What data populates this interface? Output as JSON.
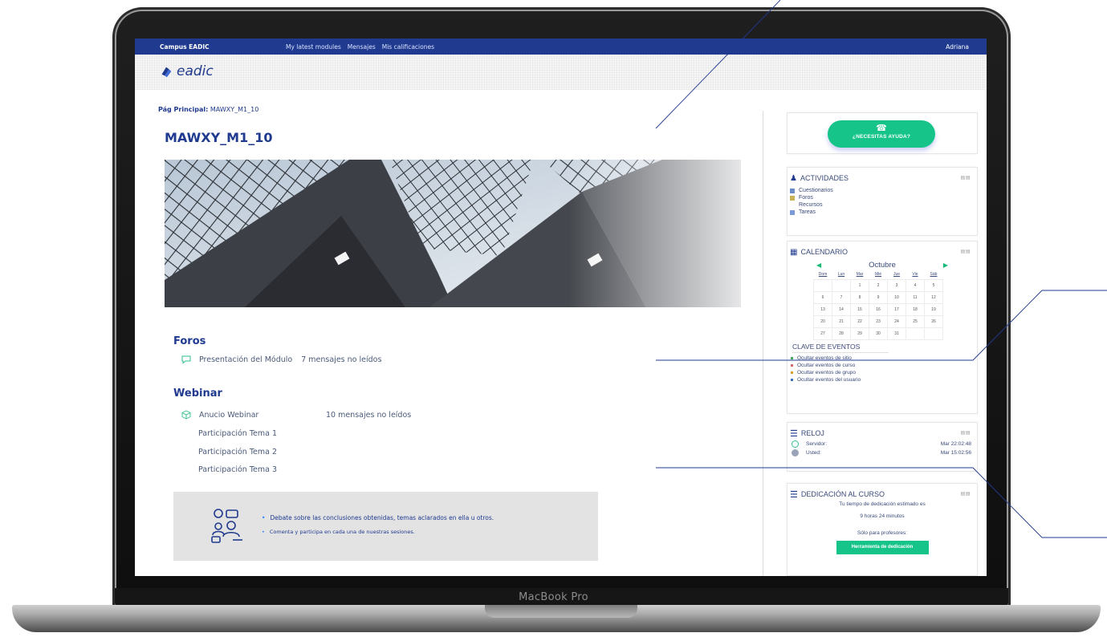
{
  "laptop": {
    "brand_label": "MacBook Pro"
  },
  "topnav": {
    "brand": "Campus EADIC",
    "links": [
      "My latest modules",
      "Mensajes",
      "Mis calificaciones"
    ],
    "user": "Adriana"
  },
  "logo": {
    "text": "eadic"
  },
  "breadcrumb": {
    "prefix": "Pág Principal:",
    "current": "MAWXY_M1_10"
  },
  "page_title": "MAWXY_M1_10",
  "sections": {
    "foros": {
      "title": "Foros",
      "items": [
        {
          "label": "Presentación del Módulo",
          "unread": "7 mensajes no leídos"
        }
      ]
    },
    "webinar": {
      "title": "Webinar",
      "items": [
        {
          "label": "Anucio Webinar",
          "unread": "10 mensajes no leídos"
        },
        {
          "label": "Participación Tema 1"
        },
        {
          "label": "Participación Tema 2"
        },
        {
          "label": "Participación Tema 3"
        }
      ]
    }
  },
  "info_box": {
    "bullets": [
      "Debate  sobre las conclusiones obtenidas, temas aclarados en ella u otros.",
      "Comenta y participa en cada una de nuestras sesiones."
    ]
  },
  "sidebar": {
    "help_button": {
      "label": "¿NECESITAS AYUDA?"
    },
    "actividades": {
      "title": "ACTIVIDADES",
      "controls": "▤▤",
      "items": [
        {
          "label": "Cuestionarios",
          "color": "#6b8cc6"
        },
        {
          "label": "Foros",
          "color": "#c9b455"
        },
        {
          "label": "Recursos",
          "color": ""
        },
        {
          "label": "Tareas",
          "color": "#7a9bd6"
        }
      ]
    },
    "calendario": {
      "title": "CALENDARIO",
      "controls": "▤▤",
      "month": "Octubre",
      "prev_icon": "◀",
      "next_icon": "▶",
      "weekdays": [
        "Dom",
        "Lun",
        "Mar",
        "Mié",
        "Jue",
        "Vie",
        "Sáb"
      ],
      "weeks": [
        [
          "",
          "",
          "1",
          "2",
          "3",
          "4",
          "5"
        ],
        [
          "6",
          "7",
          "8",
          "9",
          "10",
          "11",
          "12"
        ],
        [
          "13",
          "14",
          "15",
          "16",
          "17",
          "18",
          "19"
        ],
        [
          "20",
          "21",
          "22",
          "23",
          "24",
          "25",
          "26"
        ],
        [
          "27",
          "28",
          "29",
          "30",
          "31",
          "",
          ""
        ]
      ],
      "clave_title": "CLAVE DE EVENTOS",
      "clave_items": [
        {
          "label": "Ocultar eventos de sitio",
          "color": "#3faa55"
        },
        {
          "label": "Ocultar eventos de curso",
          "color": "#d46a6a"
        },
        {
          "label": "Ocultar eventos de grupo",
          "color": "#d9a02e"
        },
        {
          "label": "Ocultar eventos del usuario",
          "color": "#3a6fc1"
        }
      ]
    },
    "reloj": {
      "title": "RELOJ",
      "controls": "▤▤",
      "rows": [
        {
          "label": "Servidor:",
          "value": "Mar 22:02:48"
        },
        {
          "label": "Usted:",
          "value": "Mar 15:02:56"
        }
      ]
    },
    "dedicacion": {
      "title": "DEDICACIÓN AL CURSO",
      "controls": "▤▤",
      "estimate_label": "Tu tiempo de dedicación estimado es",
      "estimate_value": "9 horas 24 minutos",
      "teachers_label": "Sólo para profesores:",
      "button": "Herramienta de dedicación"
    }
  }
}
